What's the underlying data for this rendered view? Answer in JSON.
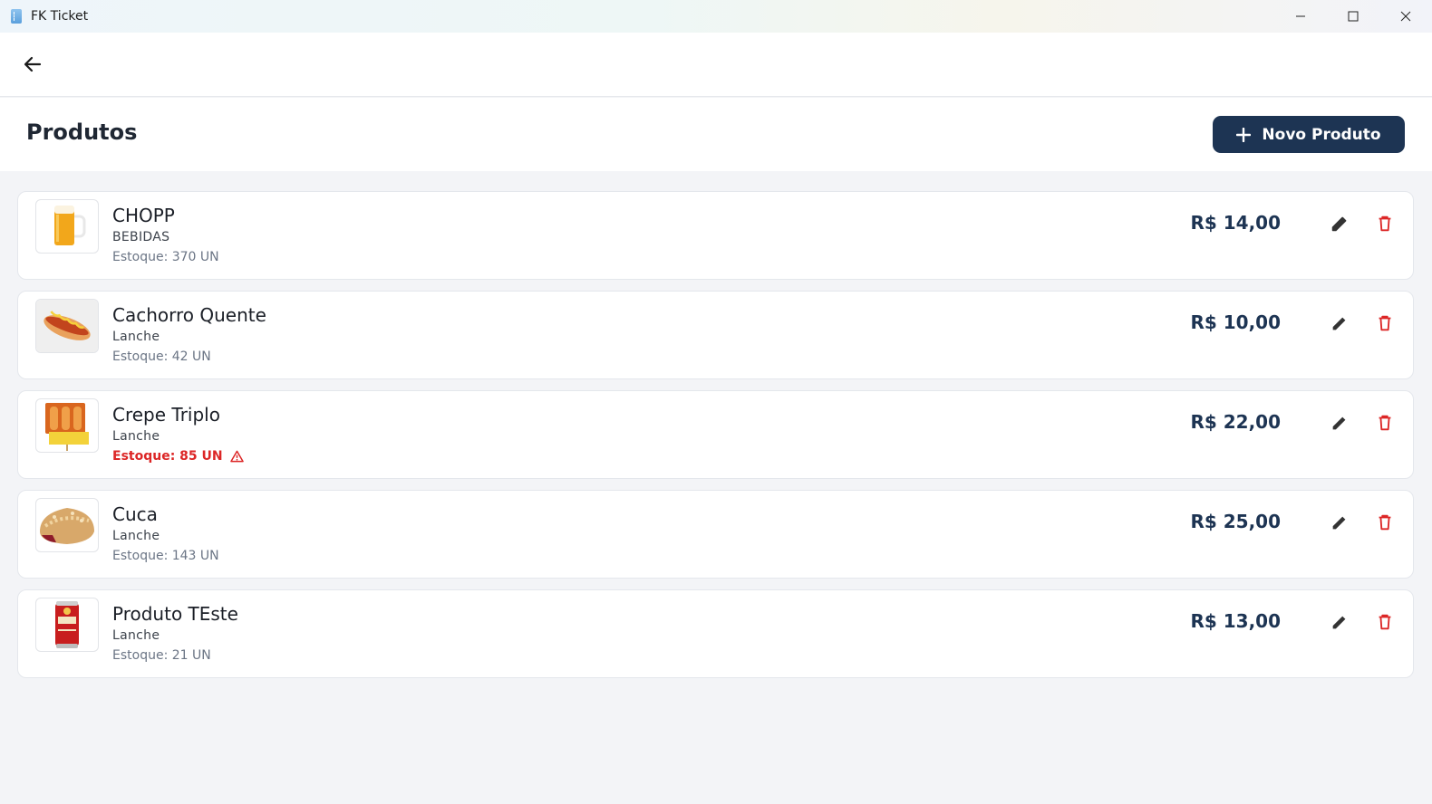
{
  "window": {
    "title": "FK Ticket"
  },
  "header": {
    "title": "Produtos",
    "new_button_label": "Novo Produto"
  },
  "colors": {
    "primary": "#1d3453",
    "danger": "#dc2626",
    "muted": "#6b7585"
  },
  "products": [
    {
      "name": "CHOPP",
      "category": "BEBIDAS",
      "stock": "Estoque: 370 UN",
      "price": "R$ 14,00",
      "low_stock": false,
      "image_icon": "beer-mug-icon"
    },
    {
      "name": "Cachorro Quente",
      "category": "Lanche",
      "stock": "Estoque: 42 UN",
      "price": "R$ 10,00",
      "low_stock": false,
      "image_icon": "hotdog-icon"
    },
    {
      "name": "Crepe Triplo",
      "category": "Lanche",
      "stock": "Estoque: 85 UN",
      "price": "R$ 22,00",
      "low_stock": true,
      "image_icon": "crepe-icon"
    },
    {
      "name": "Cuca",
      "category": "Lanche",
      "stock": "Estoque: 143 UN",
      "price": "R$ 25,00",
      "low_stock": false,
      "image_icon": "cake-icon"
    },
    {
      "name": "Produto TEste",
      "category": "Lanche",
      "stock": "Estoque: 21 UN",
      "price": "R$ 13,00",
      "low_stock": false,
      "image_icon": "beer-can-icon"
    }
  ]
}
